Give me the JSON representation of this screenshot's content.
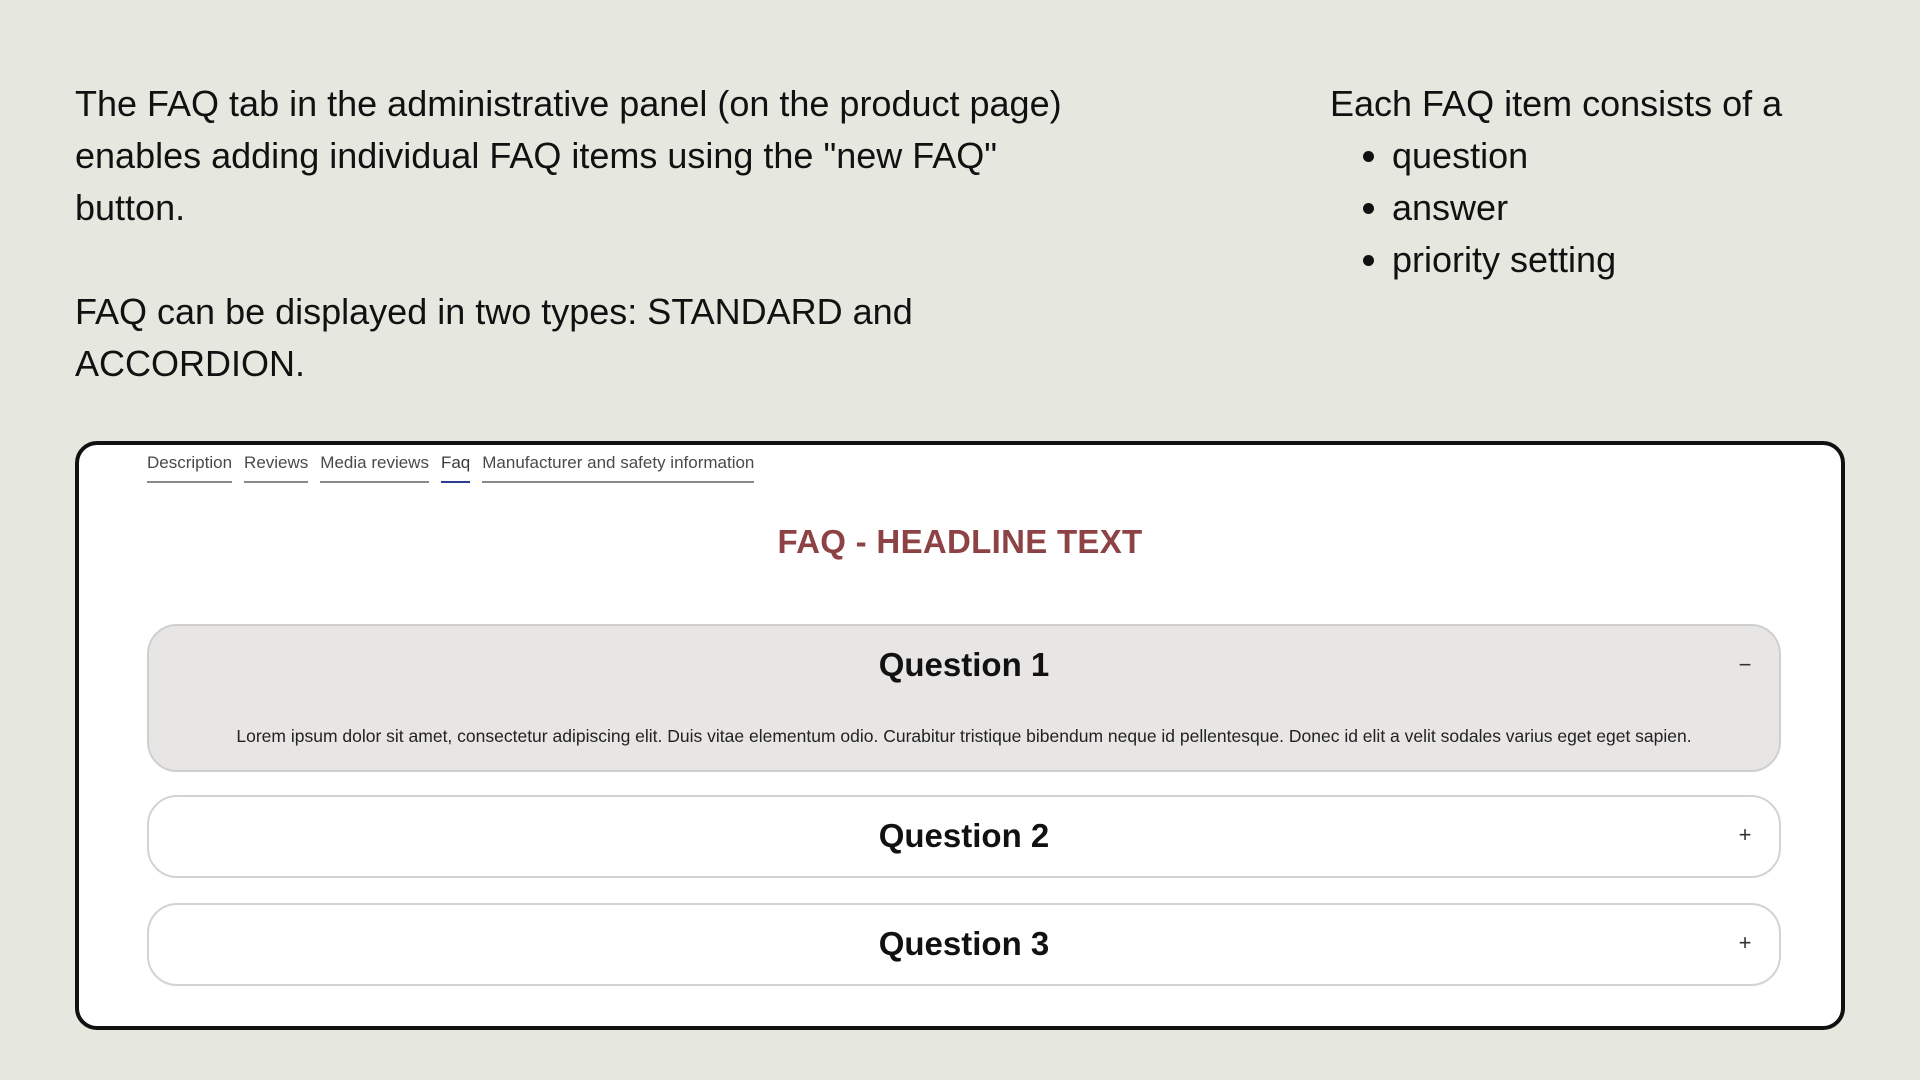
{
  "intro": {
    "left_paragraph_1": "The FAQ tab in the administrative panel (on the product page) enables adding individual FAQ items using the \"new FAQ\" button.",
    "left_paragraph_2": "FAQ can be displayed in two types: STANDARD and ACCORDION.",
    "right_heading": "Each FAQ item consists of a",
    "right_items": [
      "question",
      "answer",
      "priority setting"
    ]
  },
  "product_tabs": [
    {
      "label": "Description",
      "active": false
    },
    {
      "label": "Reviews",
      "active": false
    },
    {
      "label": "Media reviews",
      "active": false
    },
    {
      "label": "Faq",
      "active": true
    },
    {
      "label": "Manufacturer and safety information",
      "active": false
    }
  ],
  "faq": {
    "headline": "FAQ - HEADLINE TEXT",
    "items": [
      {
        "question": "Question 1",
        "expanded": true,
        "toggle_symbol": "−",
        "answer": "Lorem ipsum dolor sit amet, consectetur adipiscing elit. Duis vitae elementum odio. Curabitur tristique bibendum neque id pellentesque. Donec id elit a velit sodales varius eget eget sapien."
      },
      {
        "question": "Question 2",
        "expanded": false,
        "toggle_symbol": "+"
      },
      {
        "question": "Question 3",
        "expanded": false,
        "toggle_symbol": "+"
      }
    ]
  },
  "colors": {
    "background": "#e6e7df",
    "headline": "#8d4345",
    "active_tab_underline": "#2b3d8f",
    "expanded_item_background": "#e8e6e4"
  }
}
